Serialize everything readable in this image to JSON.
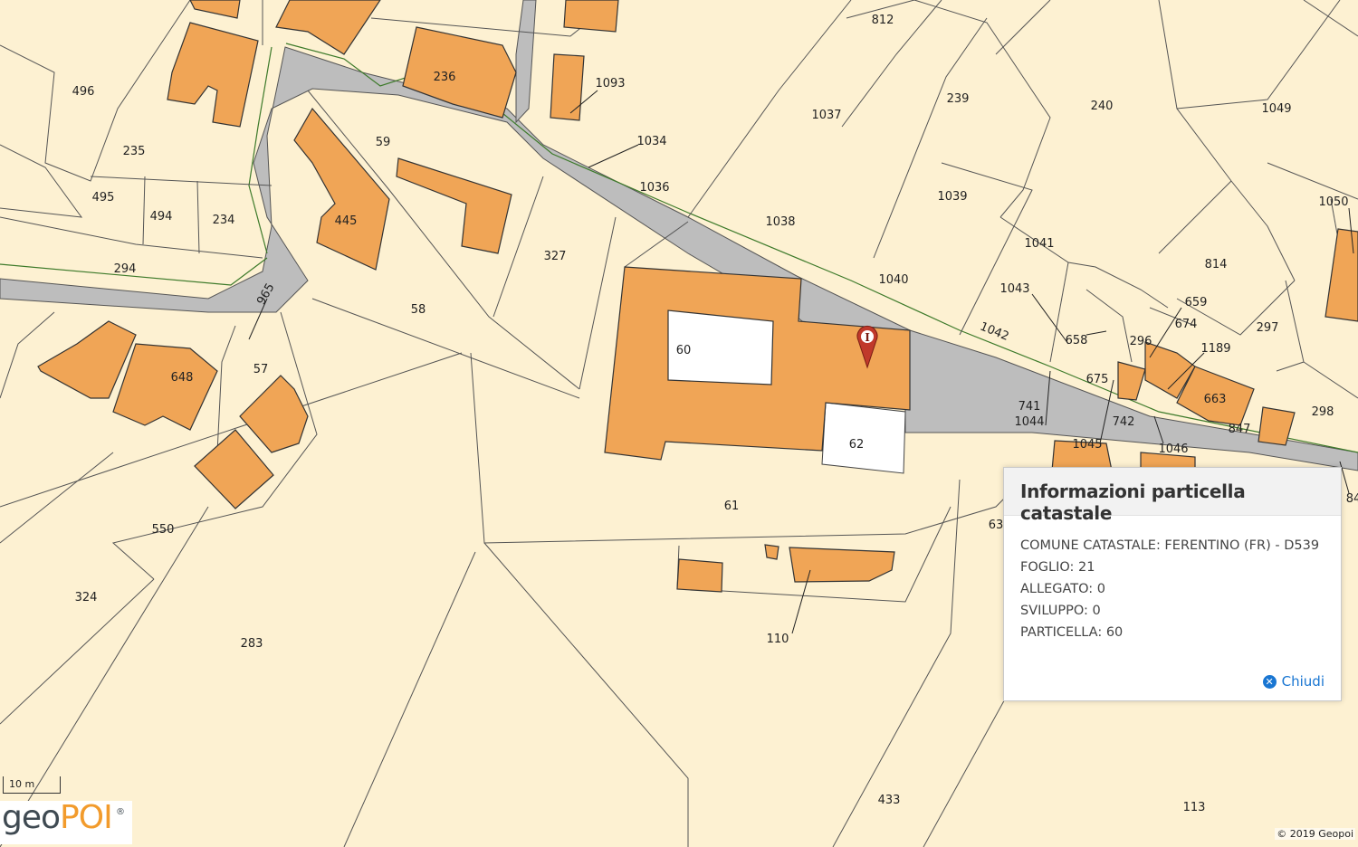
{
  "map": {
    "parcel_labels": [
      "496",
      "235",
      "495",
      "494",
      "234",
      "294",
      "236",
      "59",
      "445",
      "1093",
      "1034",
      "1036",
      "812",
      "239",
      "240",
      "1049",
      "1037",
      "1039",
      "1038",
      "1041",
      "1040",
      "1050",
      "814",
      "1043",
      "659",
      "674",
      "658",
      "296",
      "1189",
      "297",
      "1042",
      "675",
      "663",
      "741",
      "1044",
      "742",
      "847",
      "298",
      "1045",
      "1046",
      "965",
      "57",
      "648",
      "58",
      "327",
      "60",
      "62",
      "61",
      "110",
      "550",
      "324",
      "283",
      "433",
      "113",
      "63",
      "84"
    ],
    "marker": {
      "label": "I",
      "color": "#c0392b"
    }
  },
  "popup": {
    "title": "Informazioni particella catastale",
    "lines": [
      "COMUNE CATASTALE: FERENTINO (FR) - D539",
      "FOGLIO: 21",
      "ALLEGATO: 0",
      "SVILUPPO: 0",
      "PARTICELLA: 60"
    ],
    "close_label": "Chiudi"
  },
  "scale": {
    "label": "10 m"
  },
  "logo": {
    "geo": "geo",
    "poi": "POI",
    "reg": "®"
  },
  "attribution": "© 2019 Geopoi",
  "colors": {
    "parcel_bg": "#fdf1d2",
    "building": "#f0a556",
    "road": "#bdbdbd",
    "accent": "#1976d2"
  }
}
